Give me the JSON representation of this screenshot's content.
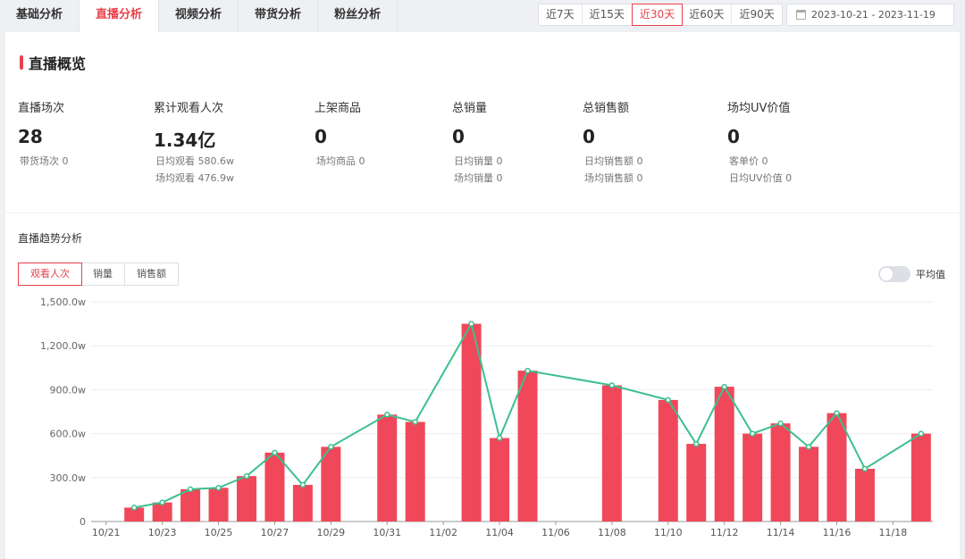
{
  "tabs": [
    {
      "label": "基础分析",
      "active": false
    },
    {
      "label": "直播分析",
      "active": true
    },
    {
      "label": "视频分析",
      "active": false
    },
    {
      "label": "带货分析",
      "active": false
    },
    {
      "label": "粉丝分析",
      "active": false
    }
  ],
  "ranges": [
    {
      "label": "近7天",
      "active": false
    },
    {
      "label": "近15天",
      "active": false
    },
    {
      "label": "近30天",
      "active": true
    },
    {
      "label": "近60天",
      "active": false
    },
    {
      "label": "近90天",
      "active": false
    }
  ],
  "date_range": "2023-10-21 - 2023-11-19",
  "overview": {
    "title": "直播概览",
    "metrics": [
      {
        "label": "直播场次",
        "value": "28",
        "subs": [
          "带货场次  0"
        ]
      },
      {
        "label": "累计观看人次",
        "value": "1.34亿",
        "subs": [
          "日均观看  580.6w",
          "场均观看  476.9w"
        ]
      },
      {
        "label": "上架商品",
        "value": "0",
        "subs": [
          "场均商品  0"
        ]
      },
      {
        "label": "总销量",
        "value": "0",
        "subs": [
          "日均销量  0",
          "场均销量  0"
        ]
      },
      {
        "label": "总销售额",
        "value": "0",
        "subs": [
          "日均销售额  0",
          "场均销售额  0"
        ]
      },
      {
        "label": "场均UV价值",
        "value": "0",
        "subs": [
          "客单价  0",
          "日均UV价值  0"
        ]
      }
    ]
  },
  "trend": {
    "title": "直播趋势分析",
    "segments": [
      {
        "label": "观看人次",
        "active": true
      },
      {
        "label": "销量",
        "active": false
      },
      {
        "label": "销售额",
        "active": false
      }
    ],
    "avg_toggle_label": "平均值",
    "avg_toggle_on": false
  },
  "colors": {
    "accent": "#e8414c",
    "bar": "#f0485a",
    "line": "#3cc08e"
  },
  "chart_data": {
    "type": "bar",
    "categories": [
      "10/21",
      "10/22",
      "10/23",
      "10/24",
      "10/25",
      "10/26",
      "10/27",
      "10/28",
      "10/29",
      "10/30",
      "10/31",
      "11/01",
      "11/02",
      "11/03",
      "11/04",
      "11/05",
      "11/06",
      "11/07",
      "11/08",
      "11/09",
      "11/10",
      "11/11",
      "11/12",
      "11/13",
      "11/14",
      "11/15",
      "11/16",
      "11/17",
      "11/18",
      "11/19"
    ],
    "xtick_labels": [
      "10/21",
      "10/23",
      "10/25",
      "10/27",
      "10/29",
      "10/31",
      "11/02",
      "11/04",
      "11/06",
      "11/08",
      "11/10",
      "11/12",
      "11/14",
      "11/16",
      "11/18"
    ],
    "values": [
      null,
      95,
      130,
      220,
      230,
      310,
      470,
      250,
      510,
      null,
      730,
      680,
      null,
      1350,
      570,
      1030,
      null,
      null,
      930,
      null,
      830,
      530,
      920,
      600,
      670,
      510,
      740,
      360,
      null,
      600
    ],
    "line_values": [
      null,
      95,
      130,
      220,
      230,
      310,
      470,
      250,
      510,
      null,
      730,
      680,
      null,
      1350,
      570,
      1030,
      null,
      null,
      930,
      null,
      830,
      530,
      920,
      600,
      670,
      510,
      740,
      360,
      null,
      600
    ],
    "yticks": [
      "0",
      "300.0w",
      "600.0w",
      "900.0w",
      "1,200.0w",
      "1,500.0w"
    ],
    "ylim": [
      0,
      1500
    ],
    "grid": true
  }
}
